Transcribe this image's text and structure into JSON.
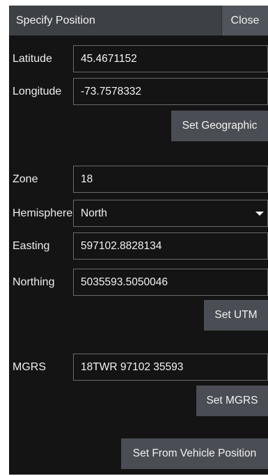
{
  "header": {
    "title": "Specify Position",
    "close_label": "Close"
  },
  "geographic": {
    "latitude_label": "Latitude",
    "latitude_value": "45.4671152",
    "longitude_label": "Longitude",
    "longitude_value": "-73.7578332",
    "set_label": "Set Geographic"
  },
  "utm": {
    "zone_label": "Zone",
    "zone_value": "18",
    "hemisphere_label": "Hemisphere",
    "hemisphere_value": "North",
    "easting_label": "Easting",
    "easting_value": "597102.8828134",
    "northing_label": "Northing",
    "northing_value": "5035593.5050046",
    "set_label": "Set UTM"
  },
  "mgrs": {
    "label": "MGRS",
    "value": "18TWR 97102 35593",
    "set_label": "Set MGRS"
  },
  "vehicle": {
    "set_label": "Set From Vehicle Position"
  },
  "colors": {
    "background": "#141414",
    "header": "#3d4146",
    "button": "#4a4e54",
    "text": "#f1f1f1"
  },
  "icons": {
    "hemisphere_dropdown": "caret-down-icon"
  }
}
